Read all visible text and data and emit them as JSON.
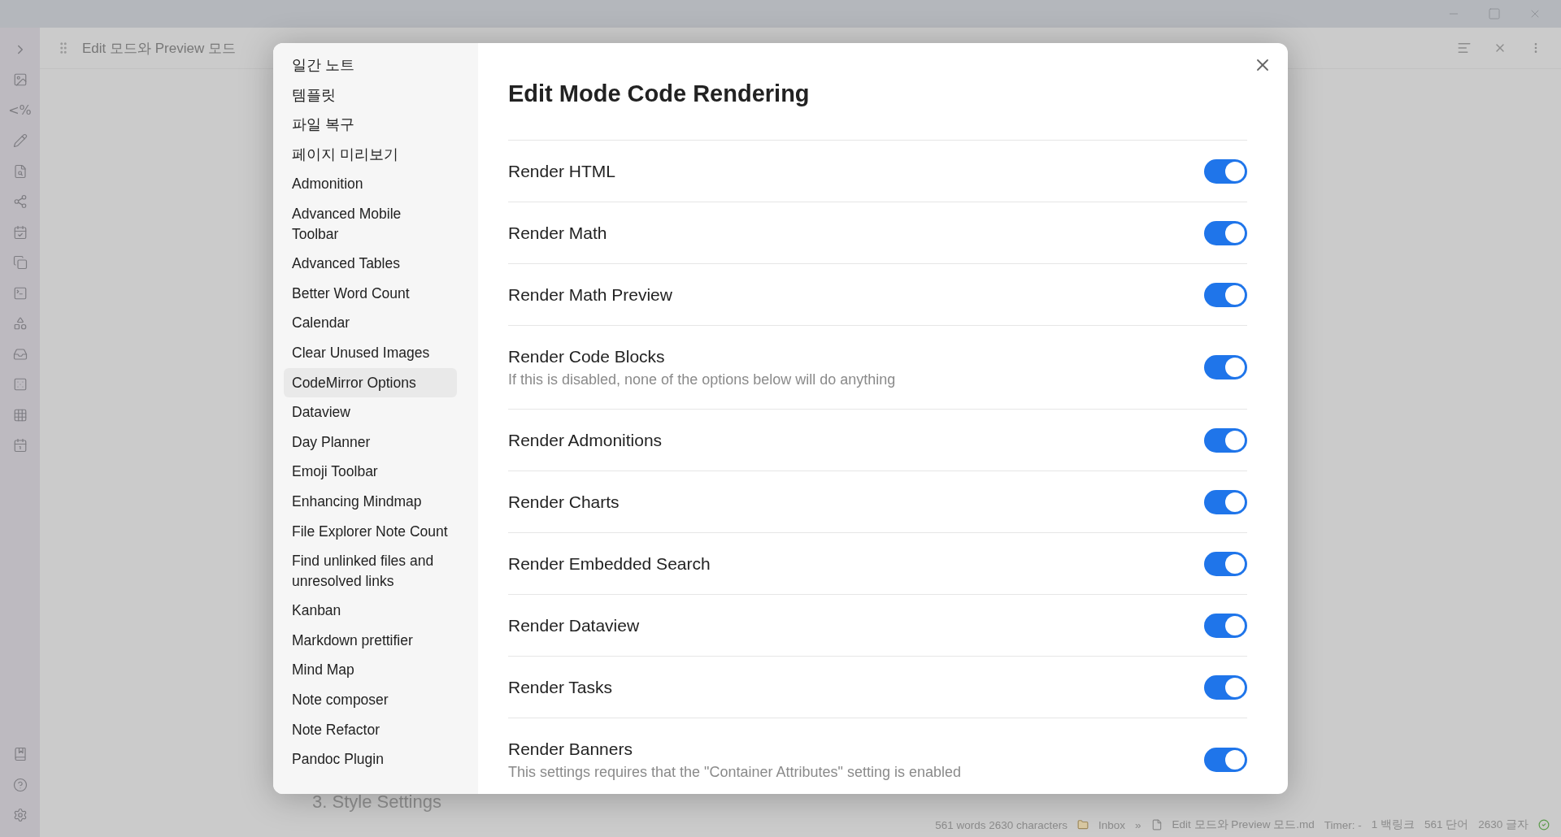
{
  "ribbon": {
    "template_label": "<%"
  },
  "tab": {
    "title": "Edit 모드와 Preview 모드"
  },
  "note": {
    "visible_heading": "3. Style Settings"
  },
  "status_bar": {
    "word_count": "561 words 2630 characters",
    "folder": "Inbox",
    "separator": "»",
    "file": "Edit 모드와 Preview 모드.md",
    "timer": "Timer: -",
    "backlinks": "1 백링크",
    "words": "561 단어",
    "characters": "2630 글자"
  },
  "settings_modal": {
    "sidebar": {
      "items": [
        {
          "label": "일간 노트",
          "selected": false
        },
        {
          "label": "템플릿",
          "selected": false
        },
        {
          "label": "파일 복구",
          "selected": false
        },
        {
          "label": "페이지 미리보기",
          "selected": false
        },
        {
          "label": "Admonition",
          "selected": false
        },
        {
          "label": "Advanced Mobile Toolbar",
          "selected": false
        },
        {
          "label": "Advanced Tables",
          "selected": false
        },
        {
          "label": "Better Word Count",
          "selected": false
        },
        {
          "label": "Calendar",
          "selected": false
        },
        {
          "label": "Clear Unused Images",
          "selected": false
        },
        {
          "label": "CodeMirror Options",
          "selected": true
        },
        {
          "label": "Dataview",
          "selected": false
        },
        {
          "label": "Day Planner",
          "selected": false
        },
        {
          "label": "Emoji Toolbar",
          "selected": false
        },
        {
          "label": "Enhancing Mindmap",
          "selected": false
        },
        {
          "label": "File Explorer Note Count",
          "selected": false
        },
        {
          "label": "Find unlinked files and unresolved links",
          "selected": false
        },
        {
          "label": "Kanban",
          "selected": false
        },
        {
          "label": "Markdown prettifier",
          "selected": false
        },
        {
          "label": "Mind Map",
          "selected": false
        },
        {
          "label": "Note composer",
          "selected": false
        },
        {
          "label": "Note Refactor",
          "selected": false
        },
        {
          "label": "Pandoc Plugin",
          "selected": false
        }
      ]
    },
    "heading": "Edit Mode Code Rendering",
    "settings": [
      {
        "name": "Render HTML",
        "on": true
      },
      {
        "name": "Render Math",
        "on": true
      },
      {
        "name": "Render Math Preview",
        "on": true
      },
      {
        "name": "Render Code Blocks",
        "description": "If this is disabled, none of the options below will do anything",
        "on": true
      },
      {
        "name": "Render Admonitions",
        "on": true
      },
      {
        "name": "Render Charts",
        "on": true
      },
      {
        "name": "Render Embedded Search",
        "on": true
      },
      {
        "name": "Render Dataview",
        "on": true
      },
      {
        "name": "Render Tasks",
        "on": true
      },
      {
        "name": "Render Banners",
        "description": "This settings requires that the \"Container Attributes\" setting is enabled",
        "on": true
      }
    ]
  }
}
